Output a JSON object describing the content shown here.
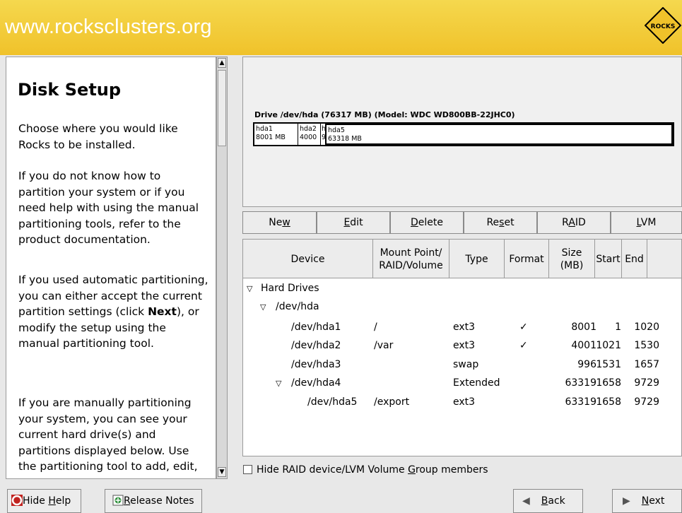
{
  "banner": {
    "url": "www.rocksclusters.org",
    "logo_text": "ROCKS"
  },
  "help": {
    "title": "Disk Setup",
    "p1": "Choose where you would like Rocks to be installed.",
    "p2": "If you do not know how to partition your system or if you need help with using the manual partitioning tools, refer to the product documentation.",
    "p3_a": "If you used automatic partitioning, you can either accept the current partition settings (click ",
    "p3_b": "Next",
    "p3_c": "), or modify the setup using the manual partitioning tool.",
    "p4": "If you are manually partitioning your system, you can see your current hard drive(s) and partitions displayed below. Use the partitioning tool to add, edit,"
  },
  "drive": {
    "label": "Drive /dev/hda (76317 MB) (Model: WDC WD800BB-22JHC0)",
    "segments": [
      {
        "name": "hda1",
        "size": "8001 MB"
      },
      {
        "name": "hda2",
        "size": "4000"
      },
      {
        "name": "h",
        "size": "9"
      },
      {
        "name": "hda5",
        "size": "63318 MB"
      }
    ]
  },
  "toolbar": {
    "new_pre": "Ne",
    "new_u": "w",
    "new_post": "",
    "edit_pre": "",
    "edit_u": "E",
    "edit_post": "dit",
    "delete_pre": "",
    "delete_u": "D",
    "delete_post": "elete",
    "reset_pre": "Re",
    "reset_u": "s",
    "reset_post": "et",
    "raid_pre": "R",
    "raid_u": "A",
    "raid_post": "ID",
    "lvm_pre": "",
    "lvm_u": "L",
    "lvm_post": "VM"
  },
  "table": {
    "headers": {
      "device": "Device",
      "mount_1": "Mount Point/",
      "mount_2": "RAID/Volume",
      "type": "Type",
      "format": "Format",
      "size_1": "Size",
      "size_2": "(MB)",
      "start": "Start",
      "end": "End"
    },
    "tree": {
      "hard_drives": "Hard Drives",
      "hda": "/dev/hda"
    },
    "rows": [
      {
        "device": "/dev/hda1",
        "mount": "/",
        "type": "ext3",
        "format": "✓",
        "size": "8001",
        "start": "1",
        "end": "1020"
      },
      {
        "device": "/dev/hda2",
        "mount": "/var",
        "type": "ext3",
        "format": "✓",
        "size": "4001",
        "start": "1021",
        "end": "1530"
      },
      {
        "device": "/dev/hda3",
        "mount": "",
        "type": "swap",
        "format": "",
        "size": "996",
        "start": "1531",
        "end": "1657"
      },
      {
        "device": "/dev/hda4",
        "mount": "",
        "type": "Extended",
        "format": "",
        "size": "63319",
        "start": "1658",
        "end": "9729"
      },
      {
        "device": "/dev/hda5",
        "mount": "/export",
        "type": "ext3",
        "format": "",
        "size": "63319",
        "start": "1658",
        "end": "9729"
      }
    ]
  },
  "hide_raid": {
    "pre": "Hide RAID device/LVM Volume ",
    "u": "G",
    "post": "roup members"
  },
  "bottom": {
    "hide_help_pre": "Hide ",
    "hide_help_u": "H",
    "hide_help_post": "elp",
    "release_pre": "",
    "release_u": "R",
    "release_post": "elease Notes",
    "back_u": "B",
    "back_post": "ack",
    "next_u": "N",
    "next_post": "ext"
  }
}
